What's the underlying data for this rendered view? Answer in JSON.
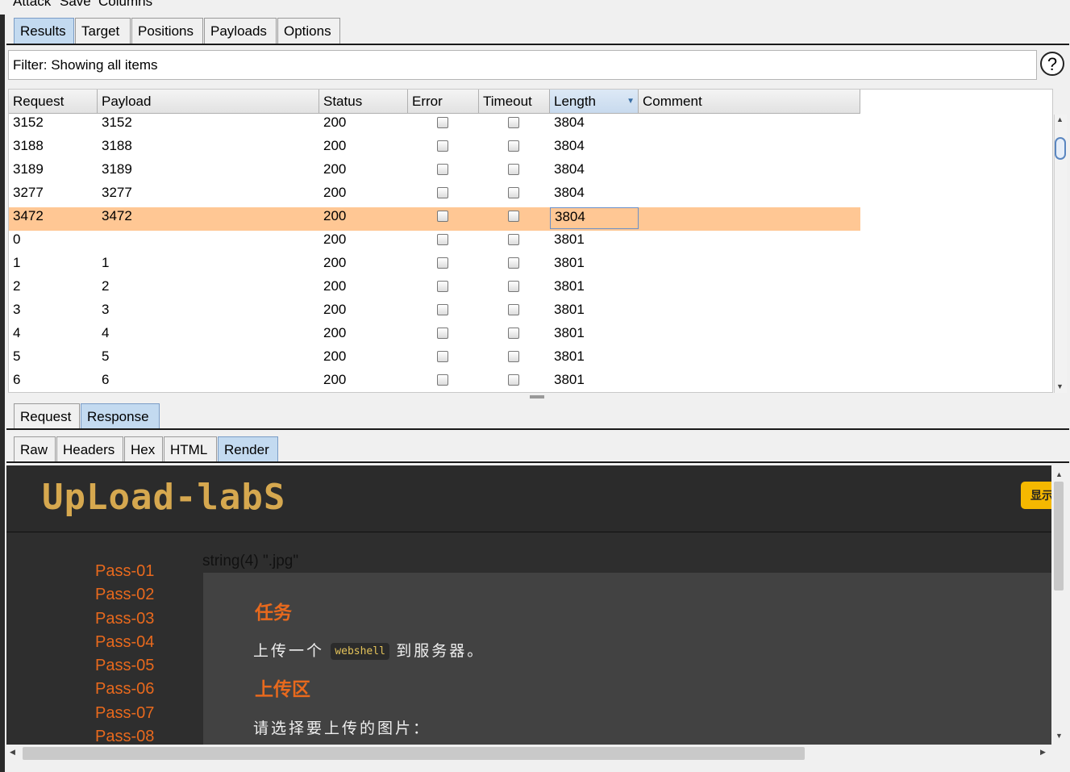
{
  "menu": [
    "Attack",
    "Save",
    "Columns"
  ],
  "main_tabs": [
    "Results",
    "Target",
    "Positions",
    "Payloads",
    "Options"
  ],
  "filter_text": "Filter: Showing all items",
  "help_label": "?",
  "table": {
    "columns": [
      "Request",
      "Payload",
      "Status",
      "Error",
      "Timeout",
      "Length",
      "Comment"
    ],
    "sorted_column": "Length",
    "rows": [
      {
        "request": "3152",
        "payload": "3152",
        "status": "200",
        "length": "3804"
      },
      {
        "request": "3188",
        "payload": "3188",
        "status": "200",
        "length": "3804"
      },
      {
        "request": "3189",
        "payload": "3189",
        "status": "200",
        "length": "3804"
      },
      {
        "request": "3277",
        "payload": "3277",
        "status": "200",
        "length": "3804"
      },
      {
        "request": "3472",
        "payload": "3472",
        "status": "200",
        "length": "3804",
        "selected": true
      },
      {
        "request": "0",
        "payload": "",
        "status": "200",
        "length": "3801"
      },
      {
        "request": "1",
        "payload": "1",
        "status": "200",
        "length": "3801"
      },
      {
        "request": "2",
        "payload": "2",
        "status": "200",
        "length": "3801"
      },
      {
        "request": "3",
        "payload": "3",
        "status": "200",
        "length": "3801"
      },
      {
        "request": "4",
        "payload": "4",
        "status": "200",
        "length": "3801"
      },
      {
        "request": "5",
        "payload": "5",
        "status": "200",
        "length": "3801"
      },
      {
        "request": "6",
        "payload": "6",
        "status": "200",
        "length": "3801"
      }
    ]
  },
  "reqresp_tabs": [
    "Request",
    "Response"
  ],
  "view_tabs": [
    "Raw",
    "Headers",
    "Hex",
    "HTML",
    "Render"
  ],
  "render": {
    "logo": "UpLoad-labS",
    "show_button": "显示",
    "nav": [
      "Pass-01",
      "Pass-02",
      "Pass-03",
      "Pass-04",
      "Pass-05",
      "Pass-06",
      "Pass-07",
      "Pass-08"
    ],
    "debug_output": "string(4) \".jpg\"",
    "task_heading": "任务",
    "task_prefix": "上传一个",
    "task_code": "webshell",
    "task_suffix": "到服务器。",
    "upload_heading": "上传区",
    "upload_prompt": "请选择要上传的图片："
  },
  "colors": {
    "selected_row": "#ffc794",
    "accent_orange": "#e8691d",
    "active_tab": "#c3daf0",
    "button_yellow": "#f5b800"
  }
}
